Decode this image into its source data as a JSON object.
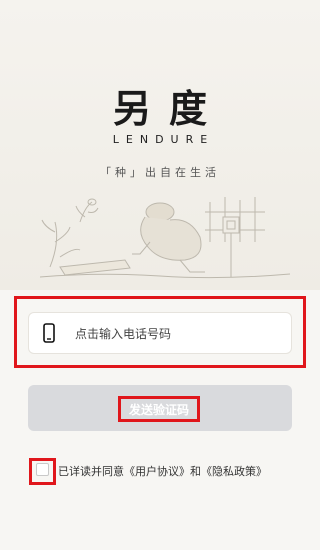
{
  "brand": {
    "name": "另度",
    "name_en": "LENDURE",
    "slogan": "「种」出自在生活"
  },
  "phone": {
    "placeholder": "点击输入电话号码",
    "icon": "smartphone-icon"
  },
  "send_button": {
    "label": "发送验证码"
  },
  "agreement": {
    "prefix": "已详读并同意",
    "user_agreement": "《用户协议》",
    "connector": "和",
    "privacy_policy": "《隐私政策》"
  },
  "colors": {
    "highlight": "#e0161b",
    "button_disabled": "#d9dadd",
    "background": "#f3f1ec"
  }
}
